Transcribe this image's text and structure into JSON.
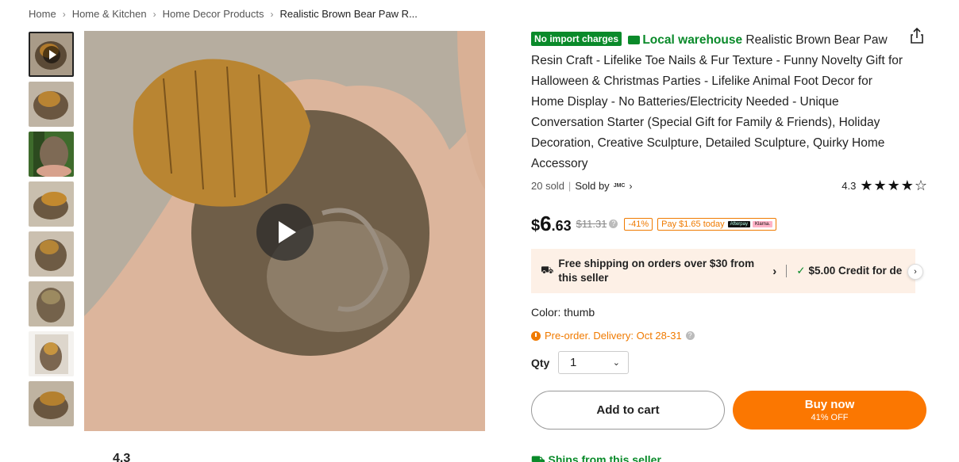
{
  "breadcrumb": [
    "Home",
    "Home & Kitchen",
    "Home Decor Products",
    "Realistic Brown Bear Paw R..."
  ],
  "product": {
    "badge": "No import charges",
    "warehouse": "Local warehouse",
    "title": "Realistic Brown Bear Paw Resin Craft - Lifelike Toe Nails & Fur Texture - Funny Novelty Gift for Halloween & Christmas Parties - Lifelike Animal Foot Decor for Home Display - No Batteries/Electricity Needed - Unique Conversation Starter (Special Gift for Family & Friends), Holiday Decoration, Creative Sculpture, Detailed Sculpture, Quirky Home Accessory",
    "sold": "20 sold",
    "sold_by": "Sold by",
    "seller_logo": "JMC",
    "rating": "4.3",
    "stars": "★★★★",
    "half_star": "☆"
  },
  "price": {
    "currency": "$",
    "integer": "6",
    "decimal": ".63",
    "original": "$11.31",
    "discount": "-41%",
    "pay_today": "Pay $1.65 today",
    "afterpay": "Afterpay",
    "klarna": "Klarna."
  },
  "shipping": {
    "text": "Free shipping on orders over $30 from this seller",
    "credit": "$5.00 Credit for de"
  },
  "color": {
    "label": "Color: thumb"
  },
  "preorder": "Pre-order. Delivery: Oct 28-31",
  "qty": {
    "label": "Qty",
    "value": "1"
  },
  "buttons": {
    "cart": "Add to cart",
    "buy": "Buy now",
    "buy_sub": "41% OFF"
  },
  "bottom": {
    "ships_from": "Ships from this seller",
    "reviews_rating": "4.3"
  },
  "colors": {
    "accent": "#fb7701",
    "green": "#0a8a2a"
  }
}
